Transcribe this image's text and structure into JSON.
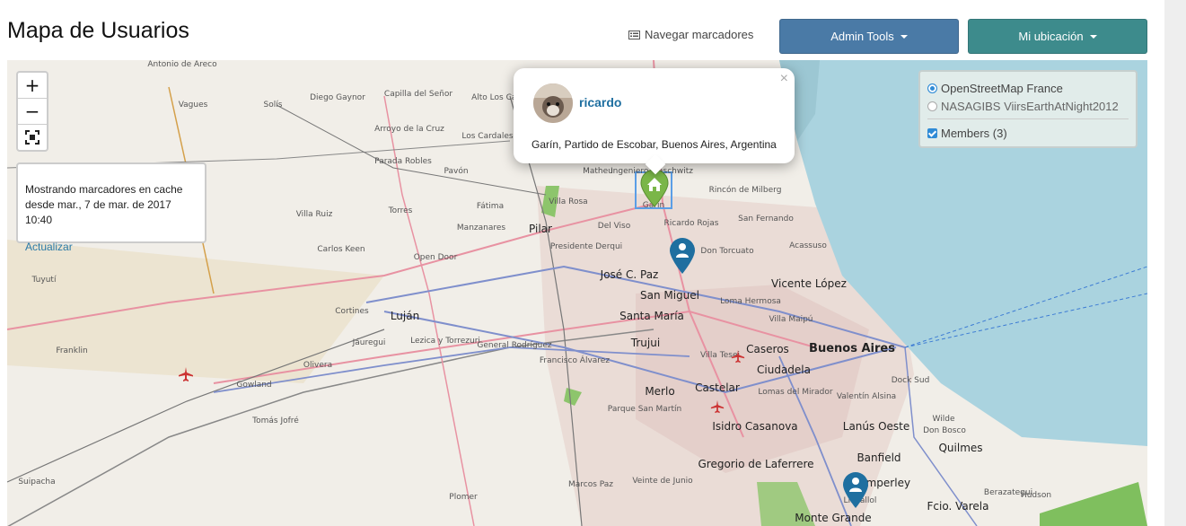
{
  "header": {
    "title": "Mapa de Usuarios",
    "nav_markers_label": "Navegar marcadores",
    "admin_tools_label": "Admin Tools",
    "my_location_label": "Mi ubicación"
  },
  "zoom": {
    "in_label": "+",
    "out_label": "−"
  },
  "cache_notice": {
    "line1": "Mostrando marcadores en cache",
    "line2": "desde mar., 7 de mar. de 2017 10:40",
    "update_link": "Actualizar"
  },
  "layers": {
    "base": [
      "OpenStreetMap France",
      "NASAGIBS ViirsEarthAtNight2012"
    ],
    "selected_base": "OpenStreetMap France",
    "overlay": "Members (3)"
  },
  "popup": {
    "close": "×",
    "username": "ricardo",
    "address": "Garín, Partido de Escobar, Buenos Aires, Argentina"
  },
  "colors": {
    "admin_button": "#4a7aa6",
    "location_button": "#3d8b8c",
    "marker_home": "#7ab648",
    "marker_member": "#1f6fa0"
  },
  "place_labels": [
    "Antonio de Areco",
    "Vagues",
    "Solís",
    "Diego Gaynor",
    "Capilla del Señor",
    "Alto Los Cardales",
    "Arroyo de la Cruz",
    "Los Cardales",
    "Parada Robles",
    "Pavón",
    "Matheu",
    "Ingeniero Maschwitz",
    "Garín",
    "Villa Rosa",
    "Fátima",
    "Villa Ruiz",
    "Torres",
    "Rincón de Milberg",
    "San Fernando",
    "Del Viso",
    "Ricardo Rojas",
    "Acassuso",
    "Manzanares",
    "Pilar",
    "Presidente Derqui",
    "Don Torcuato",
    "Carlos Keen",
    "Open Door",
    "José C. Paz",
    "Tuyutí",
    "San Miguel",
    "Vicente López",
    "Loma Hermosa",
    "Cortines",
    "Luján",
    "Santa María",
    "Villa Maipú",
    "Jáuregui",
    "Lezica y Torrezuri",
    "General Rodríguez",
    "Trujui",
    "Caseros",
    "Buenos Aires",
    "Villa Tesei",
    "Franklin",
    "Olivera",
    "Francisco Álvarez",
    "Ciudadela",
    "Gowland",
    "Merlo",
    "Castelar",
    "Lomas del Mirador",
    "Valentín Alsina",
    "Dock Sud",
    "Parque San Martín",
    "Tomás Jofré",
    "Isidro Casanova",
    "Lanús Oeste",
    "Wilde",
    "Don Bosco",
    "Banfield",
    "Quilmes",
    "Gregorio de Laferrere",
    "Berazategui",
    "Suipacha",
    "Marcos Paz",
    "Veinte de Junio",
    "Temperley",
    "Llavallol",
    "Hudson",
    "Plomer",
    "Monte Grande",
    "Fcio. Varela"
  ]
}
